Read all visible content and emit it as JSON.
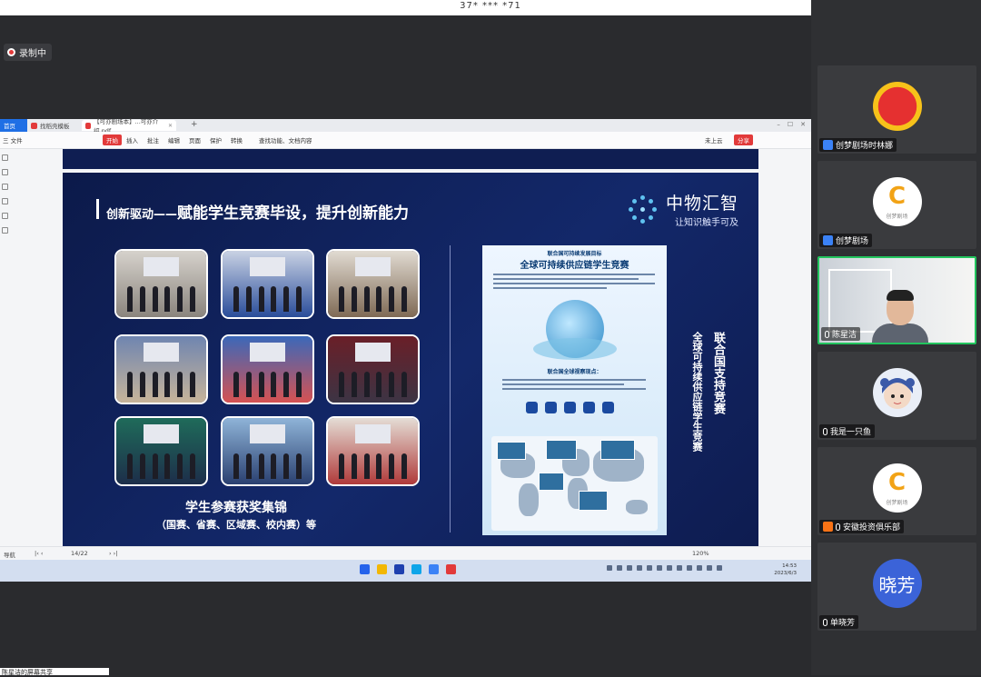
{
  "meeting": {
    "id": "37* *** *71",
    "recording_label": "录制中"
  },
  "browser": {
    "tabs": [
      {
        "label": "首页"
      },
      {
        "label": "找稻壳模板"
      },
      {
        "label": "【可亦剧场本】...可亦介绍.pdf"
      }
    ],
    "toolbar": {
      "file": "三 文件",
      "start": "开始",
      "insert": "插入",
      "annotate": "批注",
      "edit": "编辑",
      "page": "页面",
      "protect": "保护",
      "convert": "转换",
      "search": "查找功能、文档内容",
      "cloud": "未上云",
      "share": "分享"
    },
    "status": {
      "nav": "导航",
      "page": "14/22",
      "zoom": "120%"
    },
    "clock": {
      "time": "14:53",
      "date": "2023/6/3"
    }
  },
  "slide": {
    "title_prefix": "创新驱动——",
    "title": "赋能学生竞赛毕设，提升创新能力",
    "logo_name": "中物汇智",
    "logo_tagline": "让知识触手可及",
    "caption_main": "学生参赛获奖集锦",
    "caption_sub": "（国赛、省赛、区域赛、校内赛）等",
    "poster": {
      "subtitle": "联合国可持续发展目标",
      "title": "全球可持续供应链学生竞赛",
      "middle": "联合国全球视察现点："
    },
    "vertical": {
      "col1": "联合国支持竞赛",
      "col2": "全球可持续供应链学生竞赛"
    },
    "photo_colors": [
      [
        "#d6d2cc",
        "#8a847d"
      ],
      [
        "#c9d2e4",
        "#2a4d9a"
      ],
      [
        "#e1dbd2",
        "#7f6a55"
      ],
      [
        "#6f85b0",
        "#c7b49a"
      ],
      [
        "#3b68b9",
        "#d65252"
      ],
      [
        "#6a1f28",
        "#3c3444"
      ],
      [
        "#1f6b5a",
        "#1d2e4a"
      ],
      [
        "#8fb4d8",
        "#2a4070"
      ],
      [
        "#e4ddd5",
        "#b03a3a"
      ]
    ]
  },
  "participants": [
    {
      "name": "创梦剧场时林娜"
    },
    {
      "name": "创梦剧场"
    },
    {
      "name": "陈星洁"
    },
    {
      "name": "我是一只鱼"
    },
    {
      "name": "安徽投资俱乐部"
    },
    {
      "name": "单晓芳",
      "avatar_text": "晓芳"
    }
  ],
  "avatar_logo": {
    "letter": "C",
    "text": "创梦剧场"
  },
  "bottom_caption": "陈星洁的屏幕共享"
}
